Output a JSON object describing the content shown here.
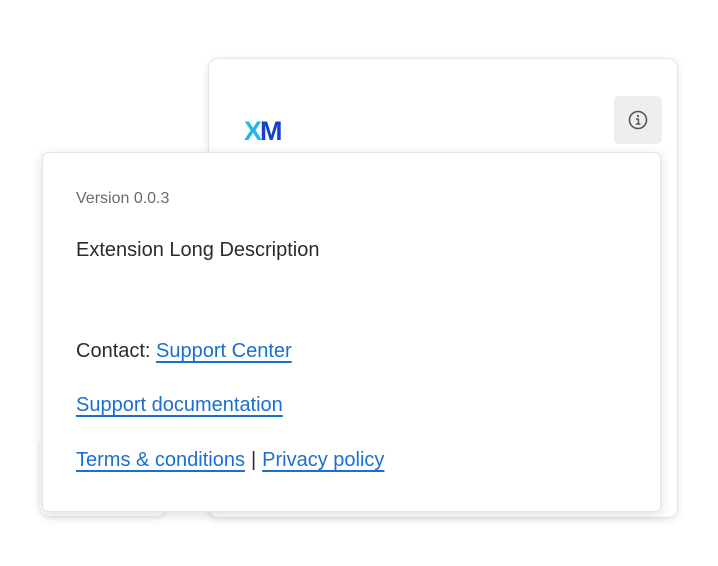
{
  "card": {
    "logo": {
      "part1": "X",
      "part2": "M",
      "colors": [
        "#1fb9e8",
        "#1740c8"
      ]
    },
    "info_icon": "info-circle-icon"
  },
  "popover": {
    "version": "Version 0.0.3",
    "description": "Extension Long Description",
    "contact_label": "Contact:",
    "support_center_link": "Support Center",
    "support_docs_link": "Support documentation",
    "terms_link": "Terms & conditions",
    "separator": "|",
    "privacy_link": "Privacy policy",
    "link_color": "#1a6fd1"
  }
}
